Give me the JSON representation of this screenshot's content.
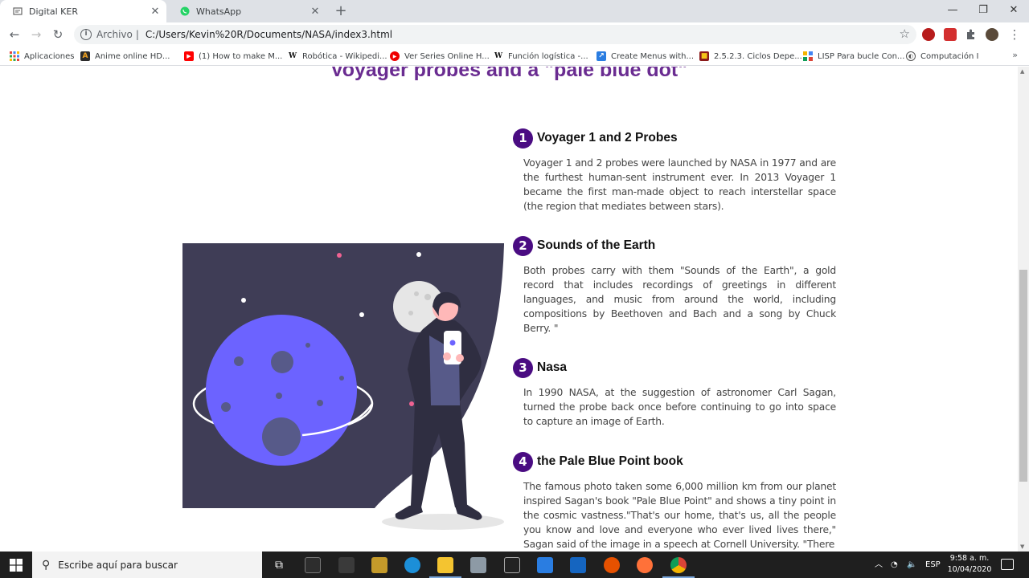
{
  "browser": {
    "tabs": [
      {
        "title": "Digital KER",
        "active": true
      },
      {
        "title": "WhatsApp",
        "active": false
      }
    ],
    "address": {
      "scheme": "Archivo",
      "url": "C:/Users/Kevin%20R/Documents/NASA/index3.html"
    },
    "bookmarks": [
      {
        "label": "Aplicaciones",
        "icon": "apps-grid-icon"
      },
      {
        "label": "Anime online HD...",
        "icon": "anime-icon"
      },
      {
        "label": "(1) How to make M...",
        "icon": "youtube-icon"
      },
      {
        "label": "Robótica - Wikipedi...",
        "icon": "wikipedia-icon"
      },
      {
        "label": "Ver Series Online H...",
        "icon": "play-icon"
      },
      {
        "label": "Función logística -...",
        "icon": "wikipedia-icon"
      },
      {
        "label": "Create Menus with...",
        "icon": "menu-site-icon"
      },
      {
        "label": "2.5.2.3. Ciclos Depe...",
        "icon": "book-icon"
      },
      {
        "label": "LISP Para bucle Con...",
        "icon": "grid-site-icon"
      },
      {
        "label": "Computación I",
        "icon": "moodle-icon"
      }
    ]
  },
  "page": {
    "title": "Voyager probes and a \"pale blue dot\"",
    "sections": [
      {
        "num": "1",
        "heading": "Voyager 1 and 2 Probes",
        "body": "Voyager 1 and 2 probes were launched by NASA in 1977 and are the furthest human-sent instrument ever. In 2013 Voyager 1 became the first man-made object to reach interstellar space (the region that mediates between stars)."
      },
      {
        "num": "2",
        "heading": "Sounds of the Earth",
        "body": "Both probes carry with them \"Sounds of the Earth\", a gold record that includes recordings of greetings in different languages, and music from around the world, including compositions by Beethoven and Bach and a song by Chuck Berry. \""
      },
      {
        "num": "3",
        "heading": "Nasa",
        "body": "In 1990 NASA, at the suggestion of astronomer Carl Sagan, turned the probe back once before continuing to go into space to capture an image of Earth."
      },
      {
        "num": "4",
        "heading": "the Pale Blue Point book",
        "body": "The famous photo taken some 6,000 million km from our planet inspired Sagan's book \"Pale Blue Point\" and shows a tiny point in the cosmic vastness.\"That's our home, that's us, all the people you know and love and everyone who ever lived lives there,\" Sagan said of the image in a speech at Cornell University. \"There"
      }
    ]
  },
  "taskbar": {
    "search_placeholder": "Escribe aquí para buscar",
    "language": "ESP",
    "time": "9:58 a. m.",
    "date": "10/04/2020"
  }
}
